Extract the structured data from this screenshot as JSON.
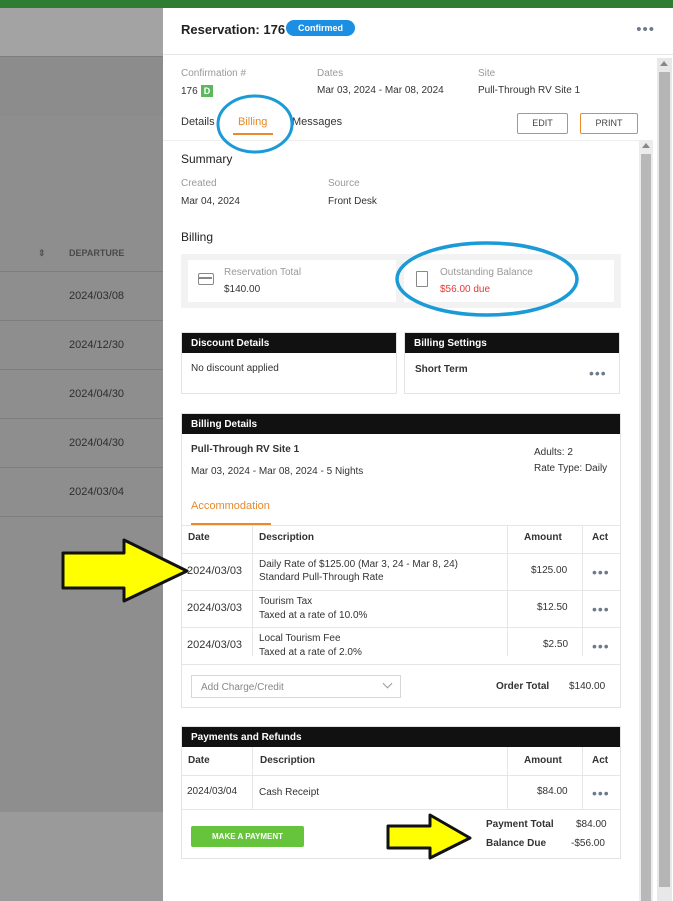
{
  "background": {
    "sort_glyph": "⇕",
    "departure_header": "DEPARTURE",
    "departures": [
      "2024/03/08",
      "2024/12/30",
      "2024/04/30",
      "2024/04/30",
      "2024/03/04"
    ]
  },
  "header": {
    "title": "Reservation: 176",
    "status_badge": "Confirmed",
    "menu_glyph": "•••"
  },
  "meta": {
    "confirmation_label": "Confirmation #",
    "confirmation_value": "176",
    "confirmation_flag": "D",
    "dates_label": "Dates",
    "dates_value": "Mar 03, 2024 - Mar 08, 2024",
    "site_label": "Site",
    "site_value": "Pull-Through RV Site 1"
  },
  "tabs": [
    {
      "label": "Details",
      "active": false
    },
    {
      "label": "Billing",
      "active": true
    },
    {
      "label": "Messages",
      "active": false
    }
  ],
  "actions": {
    "edit": "EDIT",
    "print": "PRINT"
  },
  "summary": {
    "heading": "Summary",
    "created_label": "Created",
    "created_value": "Mar 04, 2024",
    "source_label": "Source",
    "source_value": "Front Desk"
  },
  "billing": {
    "heading": "Billing",
    "reservation_total_label": "Reservation Total",
    "reservation_total_value": "$140.00",
    "outstanding_label": "Outstanding Balance",
    "outstanding_value": "$56.00 due"
  },
  "discount": {
    "heading": "Discount Details",
    "text": "No discount applied"
  },
  "billing_settings": {
    "heading": "Billing Settings",
    "value": "Short Term"
  },
  "billing_details": {
    "heading": "Billing Details",
    "site": "Pull-Through RV Site 1",
    "dates_nights": "Mar 03, 2024 - Mar 08, 2024 - 5 Nights",
    "adults": "Adults: 2",
    "rate_type": "Rate Type: Daily",
    "subtab": "Accommodation",
    "columns": {
      "date": "Date",
      "description": "Description",
      "amount": "Amount",
      "action": "Act"
    },
    "rows": [
      {
        "date": "2024/03/03",
        "desc1": "Daily Rate of $125.00 (Mar 3, 24 - Mar 8, 24)",
        "desc2": "Standard Pull-Through Rate",
        "amount": "$125.00"
      },
      {
        "date": "2024/03/03",
        "desc1": "Tourism Tax",
        "desc2": "Taxed at a rate of 10.0%",
        "amount": "$12.50"
      },
      {
        "date": "2024/03/03",
        "desc1": "Local Tourism Fee",
        "desc2": "Taxed at a rate of 2.0%",
        "amount": "$2.50"
      }
    ],
    "add_charge_placeholder": "Add Charge/Credit",
    "order_total_label": "Order Total",
    "order_total_value": "$140.00"
  },
  "payments": {
    "heading": "Payments and Refunds",
    "columns": {
      "date": "Date",
      "description": "Description",
      "amount": "Amount",
      "action": "Act"
    },
    "rows": [
      {
        "date": "2024/03/04",
        "desc": "Cash Receipt",
        "amount": "$84.00"
      }
    ],
    "make_payment": "MAKE A PAYMENT",
    "payment_total_label": "Payment Total",
    "payment_total_value": "$84.00",
    "balance_due_label": "Balance Due",
    "balance_due_value": "-$56.00"
  },
  "row_menu_glyph": "•••",
  "colors": {
    "accent": "#e8892a",
    "badge": "#1a8fe3",
    "due": "#e53935",
    "pay_button": "#66c33c",
    "annotation_circle": "#1a9ad6",
    "annotation_arrow": "#ffff00"
  }
}
